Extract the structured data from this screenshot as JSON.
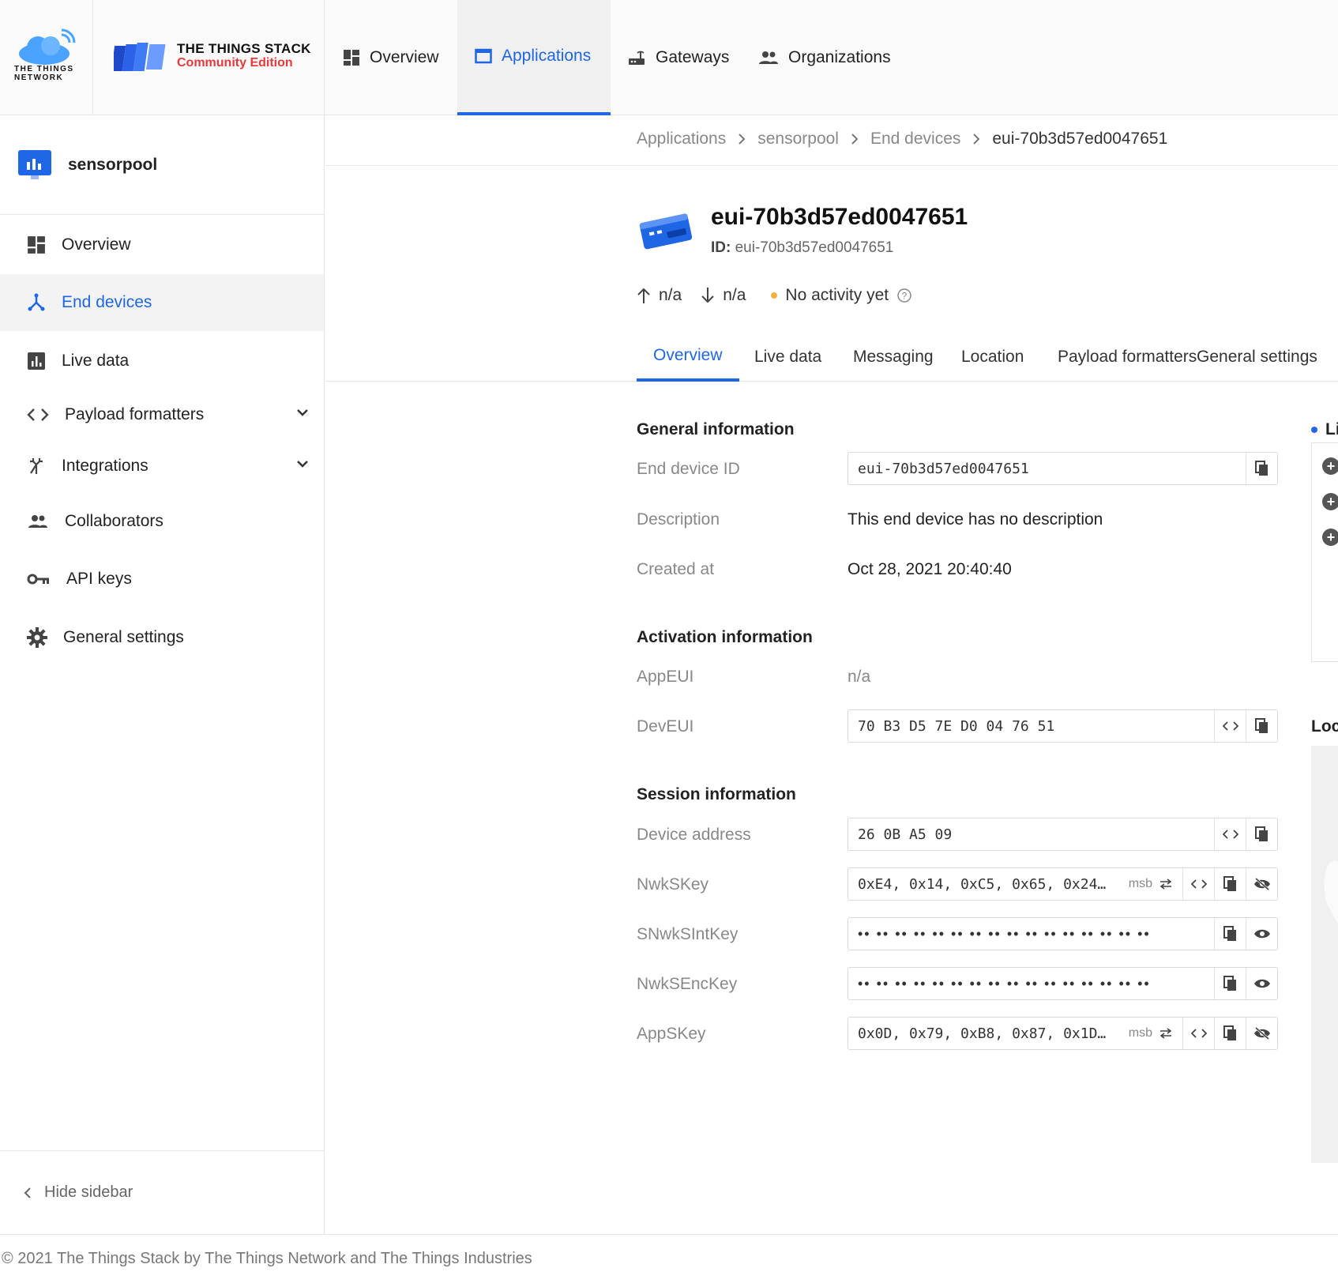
{
  "header": {
    "ttn_logo_text": "THE THINGS NETWORK",
    "tts_title": "THE THINGS STACK",
    "tts_subtitle": "Community Edition",
    "nav": [
      {
        "label": "Overview",
        "icon": "dashboard-icon"
      },
      {
        "label": "Applications",
        "icon": "application-icon",
        "active": true
      },
      {
        "label": "Gateways",
        "icon": "gateway-icon"
      },
      {
        "label": "Organizations",
        "icon": "organizations-icon"
      }
    ]
  },
  "sidebar": {
    "app_name": "sensorpool",
    "items": [
      {
        "label": "Overview",
        "icon": "dashboard-icon"
      },
      {
        "label": "End devices",
        "icon": "device-icon",
        "active": true
      },
      {
        "label": "Live data",
        "icon": "chart-icon"
      },
      {
        "label": "Payload formatters",
        "icon": "code-icon",
        "expandable": true
      },
      {
        "label": "Integrations",
        "icon": "integration-icon",
        "expandable": true
      },
      {
        "label": "Collaborators",
        "icon": "people-icon"
      },
      {
        "label": "API keys",
        "icon": "key-icon"
      },
      {
        "label": "General settings",
        "icon": "gear-icon"
      }
    ],
    "hide_label": "Hide sidebar"
  },
  "breadcrumb": [
    "Applications",
    "sensorpool",
    "End devices",
    "eui-70b3d57ed0047651"
  ],
  "device": {
    "title": "eui-70b3d57ed0047651",
    "id_label": "ID:",
    "id_value": "eui-70b3d57ed0047651",
    "uplink": "n/a",
    "downlink": "n/a",
    "activity": "No activity yet"
  },
  "tabs": [
    "Overview",
    "Live data",
    "Messaging",
    "Location",
    "Payload formatters",
    "General settings"
  ],
  "general": {
    "title": "General information",
    "end_device_id_label": "End device ID",
    "end_device_id": "eui-70b3d57ed0047651",
    "description_label": "Description",
    "description": "This end device has no description",
    "created_label": "Created at",
    "created": "Oct 28, 2021 20:40:40"
  },
  "activation": {
    "title": "Activation information",
    "appeui_label": "AppEUI",
    "appeui": "n/a",
    "deveui_label": "DevEUI",
    "deveui": "70 B3 D5 7E D0 04 76 51"
  },
  "session": {
    "title": "Session information",
    "devaddr_label": "Device address",
    "devaddr": "26 0B A5 09",
    "nwkskey_label": "NwkSKey",
    "nwkskey": "0xE4, 0x14, 0xC5, 0x65, 0x24…",
    "snwksintkey_label": "SNwkSIntKey",
    "snwksintkey": "•• •• •• •• •• •• •• •• •• •• •• •• •• •• •• ••",
    "nwksenckey_label": "NwkSEncKey",
    "nwksenckey": "•• •• •• •• •• •• •• •• •• •• •• •• •• •• •• ••",
    "appskey_label": "AppSKey",
    "appskey": "0x0D, 0x79, 0xB8, 0x87, 0x1D…",
    "msb_label": "msb"
  },
  "right_panel": {
    "live_heading": "Li",
    "location_heading": "Loc"
  },
  "footer": "© 2021 The Things Stack by The Things Network and The Things Industries",
  "colors": {
    "accent": "#1f66e5",
    "brand_red": "#e6393a",
    "status_dot": "#f5b041"
  }
}
